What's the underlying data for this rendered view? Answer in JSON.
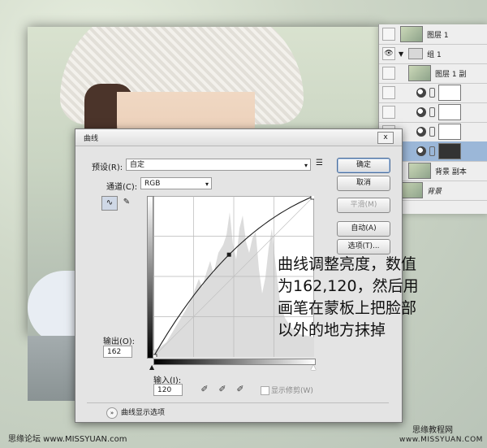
{
  "layers_panel": {
    "layers": [
      {
        "name": "图层 1",
        "thumb": "photo",
        "eye": false
      },
      {
        "name": "组 1",
        "thumb": "folder",
        "eye": true
      },
      {
        "name": "图层 1 副",
        "thumb": "photo",
        "eye": false
      },
      {
        "name": "",
        "thumb": "adjust-white",
        "eye": false
      },
      {
        "name": "",
        "thumb": "adjust-white",
        "eye": false
      },
      {
        "name": "",
        "thumb": "adjust-white",
        "eye": false
      },
      {
        "name": "",
        "thumb": "adjust-mask",
        "eye": false
      },
      {
        "name": "背景 副本",
        "thumb": "photo",
        "eye": false
      },
      {
        "name": "背景",
        "thumb": "photo",
        "eye": false
      }
    ],
    "selected_index": 6
  },
  "dialog": {
    "title": "曲线",
    "close_label": "x",
    "preset_label": "预设(R):",
    "preset_value": "自定",
    "channel_label": "通道(C):",
    "channel_value": "RGB",
    "ok_label": "确定",
    "cancel_label": "取消",
    "smooth_label": "平滑(M)",
    "auto_label": "自动(A)",
    "options_label": "选项(T)...",
    "output_label": "输出(O):",
    "output_value": "162",
    "input_label": "输入(I):",
    "input_value": "120",
    "show_clipping_label": "显示修剪(W)",
    "display_options_label": "曲线显示选项",
    "curve_point": {
      "input": 120,
      "output": 162
    }
  },
  "annotation": {
    "lines": [
      "曲线调整亮度，数值",
      "为162,120，然后用",
      "画笔在蒙板上把脸部",
      "以外的地方抹掉"
    ]
  },
  "watermark": {
    "left": "思缘论坛 www.MISSYUAN.com",
    "right_top": "思缘教程网",
    "right_bottom": "www.MISSYUAN.COM"
  },
  "colors": {
    "selected_row": "#9bb7d8",
    "dialog_bg": "#e4e4e4"
  }
}
